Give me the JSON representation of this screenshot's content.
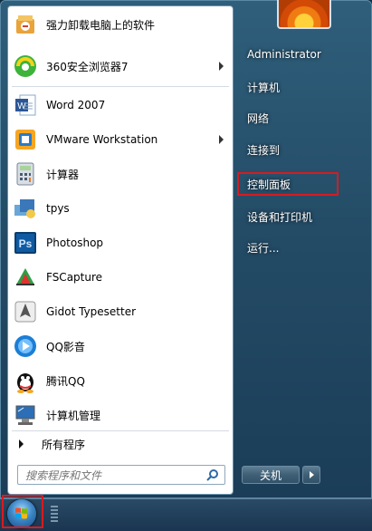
{
  "programs": [
    {
      "label": "强力卸载电脑上的软件",
      "icon": "uninstall-icon",
      "submenu": false
    },
    {
      "label": "360安全浏览器7",
      "icon": "browser-360-icon",
      "submenu": true
    },
    {
      "label": "Word 2007",
      "icon": "word-icon",
      "submenu": false
    },
    {
      "label": "VMware Workstation",
      "icon": "vmware-icon",
      "submenu": true
    },
    {
      "label": "计算器",
      "icon": "calculator-icon",
      "submenu": false
    },
    {
      "label": "tpys",
      "icon": "tpys-icon",
      "submenu": false
    },
    {
      "label": "Photoshop",
      "icon": "photoshop-icon",
      "submenu": false
    },
    {
      "label": "FSCapture",
      "icon": "fscapture-icon",
      "submenu": false
    },
    {
      "label": "Gidot Typesetter",
      "icon": "typesetter-icon",
      "submenu": false
    },
    {
      "label": "QQ影音",
      "icon": "qqplayer-icon",
      "submenu": false
    },
    {
      "label": "腾讯QQ",
      "icon": "qq-icon",
      "submenu": false
    },
    {
      "label": "计算机管理",
      "icon": "computer-management-icon",
      "submenu": false
    }
  ],
  "all_programs": "所有程序",
  "search": {
    "placeholder": "搜索程序和文件"
  },
  "right_panel": [
    {
      "label": "Administrator"
    },
    {
      "label": "计算机"
    },
    {
      "label": "网络"
    },
    {
      "label": "连接到"
    },
    {
      "label": "控制面板"
    },
    {
      "label": "设备和打印机"
    },
    {
      "label": "运行..."
    }
  ],
  "shutdown": {
    "label": "关机"
  },
  "colors": {
    "highlight": "#d81b20",
    "panel": "#244c67"
  }
}
